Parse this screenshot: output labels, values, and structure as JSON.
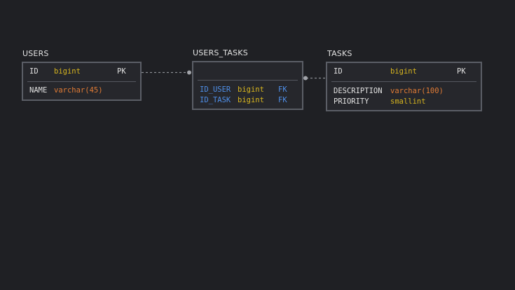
{
  "colors": {
    "background": "#1f2024",
    "table_border": "#5b5e66",
    "table_fill": "#26272c",
    "type_yellow": "#d7b51f",
    "type_orange": "#e07b35",
    "fk_blue": "#4f8fe8",
    "connector": "#8a8c92"
  },
  "tables": {
    "users": {
      "title": "USERS",
      "pk": {
        "name": "ID",
        "type": "bigint",
        "key": "PK"
      },
      "columns": [
        {
          "name": "NAME",
          "type": "varchar(45)"
        }
      ]
    },
    "users_tasks": {
      "title": "USERS_TASKS",
      "columns": [
        {
          "name": "ID_USER",
          "type": "bigint",
          "key": "FK"
        },
        {
          "name": "ID_TASK",
          "type": "bigint",
          "key": "FK"
        }
      ]
    },
    "tasks": {
      "title": "TASKS",
      "pk": {
        "name": "ID",
        "type": "bigint",
        "key": "PK"
      },
      "columns": [
        {
          "name": "DESCRIPTION",
          "type": "varchar(100)"
        },
        {
          "name": "PRIORITY",
          "type": "smallint"
        }
      ]
    }
  }
}
